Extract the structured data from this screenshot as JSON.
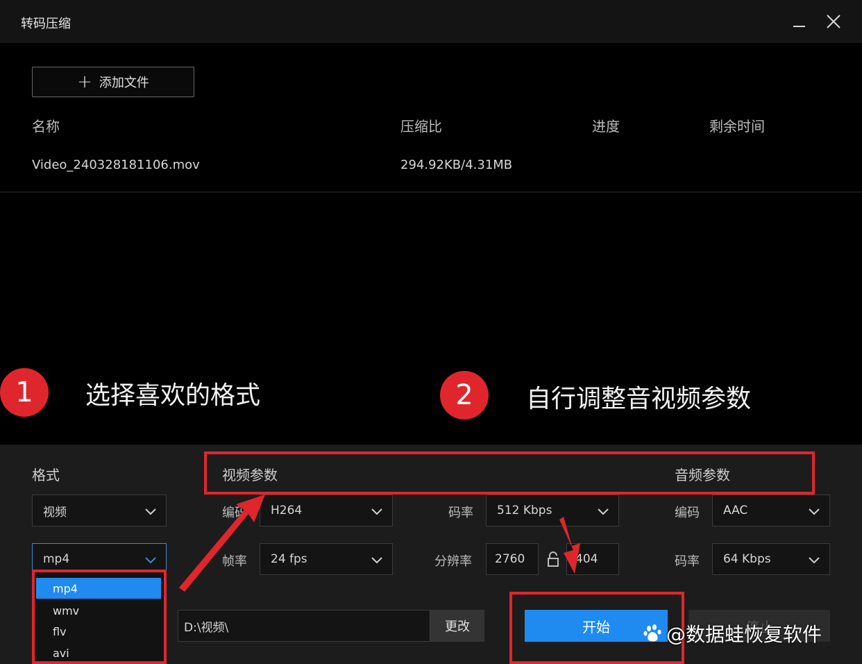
{
  "window": {
    "title": "转码压缩",
    "minimize_icon": "minimize-icon",
    "close_icon": "close-icon"
  },
  "toolbar": {
    "add_file_label": "添加文件",
    "add_icon": "plus-icon"
  },
  "file_table": {
    "headers": [
      "名称",
      "压缩比",
      "进度",
      "剩余时间"
    ],
    "rows": [
      {
        "name": "Video_240328181106.mov",
        "ratio": "294.92KB/4.31MB",
        "progress": "",
        "remaining": ""
      }
    ]
  },
  "annotations": {
    "step1": {
      "number": "1",
      "text": "选择喜欢的格式"
    },
    "step2": {
      "number": "2",
      "text": "自行调整音视频参数"
    },
    "accent_color": "#e0262d"
  },
  "format": {
    "label": "格式",
    "type_value": "视频",
    "container_value": "mp4",
    "options": [
      "mp4",
      "wmv",
      "flv",
      "avi"
    ],
    "selected_option": "mp4"
  },
  "video_params": {
    "label": "视频参数",
    "codec_label": "编码",
    "codec_value": "H264",
    "bitrate_label": "码率",
    "bitrate_value": "512 Kbps",
    "fps_label": "帧率",
    "fps_value": "24 fps",
    "resolution_label": "分辨率",
    "width_value": "2760",
    "height_value": "404",
    "lock_icon": "lock-icon"
  },
  "audio_params": {
    "label": "音频参数",
    "codec_label": "编码",
    "codec_value": "AAC",
    "bitrate_label": "码率",
    "bitrate_value": "64 Kbps"
  },
  "output": {
    "path_value": "D:\\视频\\",
    "change_label": "更改"
  },
  "actions": {
    "start_label": "开始",
    "stop_label": "停止",
    "primary_color": "#1f8bf0"
  },
  "watermark": {
    "text": "@数据蛙恢复软件",
    "icon": "baidu-paw-icon"
  }
}
